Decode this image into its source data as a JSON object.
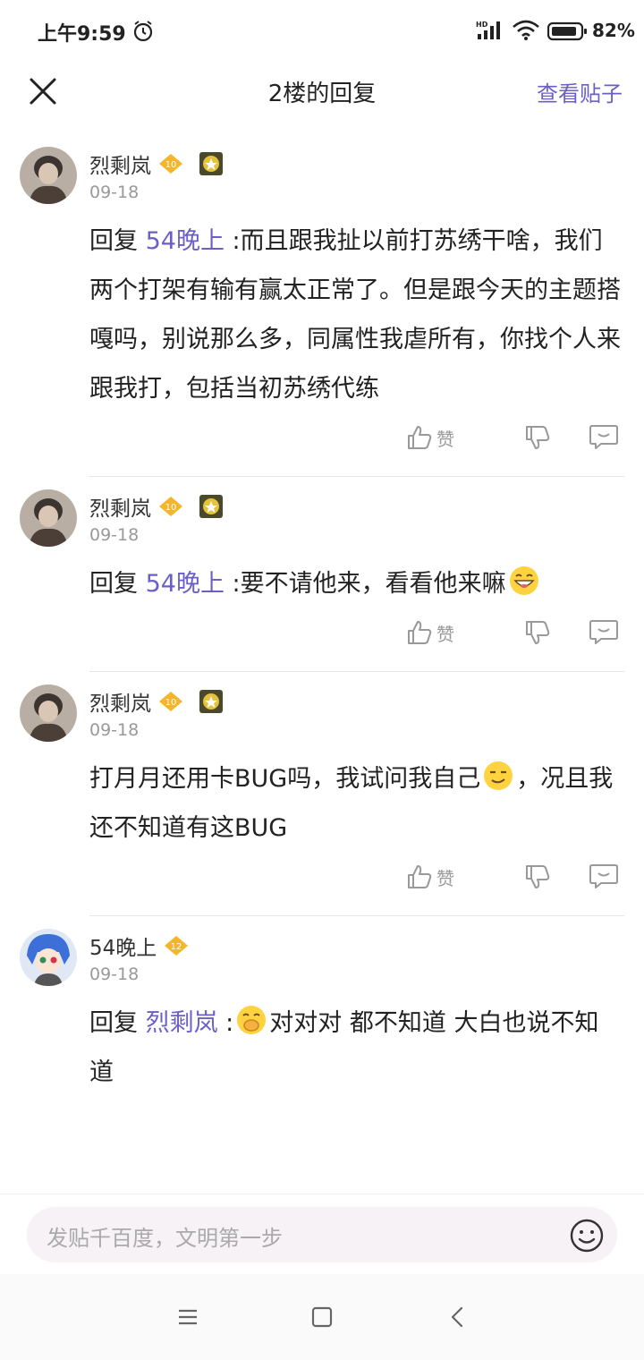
{
  "status_bar": {
    "time": "上午9:59",
    "battery": "82%",
    "network_label": "HD"
  },
  "nav": {
    "title": "2楼的回复",
    "view_post": "查看贴子"
  },
  "accent_color": "#6b5fc7",
  "replies": [
    {
      "username": "烈剩岚",
      "level": "10",
      "has_medal": true,
      "date": "09-18",
      "prefix": "回复 ",
      "mention": "54晚上",
      "text": " :而且跟我扯以前打苏绣干啥，我们两个打架有输有赢太正常了。但是跟今天的主题搭嘎吗，别说那么多，同属性我虐所有，你找个人来跟我打，包括当初苏绣代练",
      "like_label": "赞"
    },
    {
      "username": "烈剩岚",
      "level": "10",
      "has_medal": true,
      "date": "09-18",
      "prefix": "回复 ",
      "mention": "54晚上",
      "text": " :要不请他来，看看他来嘛",
      "emoji": "grin-emoji",
      "like_label": "赞"
    },
    {
      "username": "烈剩岚",
      "level": "10",
      "has_medal": true,
      "date": "09-18",
      "text_a": "打月月还用卡BUG吗，我试问我自己",
      "emoji": "smirk-emoji",
      "text_b": "，况且我还不知道有这BUG",
      "like_label": "赞"
    },
    {
      "username": "54晚上",
      "level": "12",
      "has_medal": false,
      "date": "09-18",
      "prefix": "回复 ",
      "mention": "烈剩岚",
      "text_a": " :",
      "emoji": "giggle-emoji",
      "text_b": "对对对 都不知道 大白也说不知道"
    }
  ],
  "input": {
    "placeholder": "发贴千百度，文明第一步"
  }
}
